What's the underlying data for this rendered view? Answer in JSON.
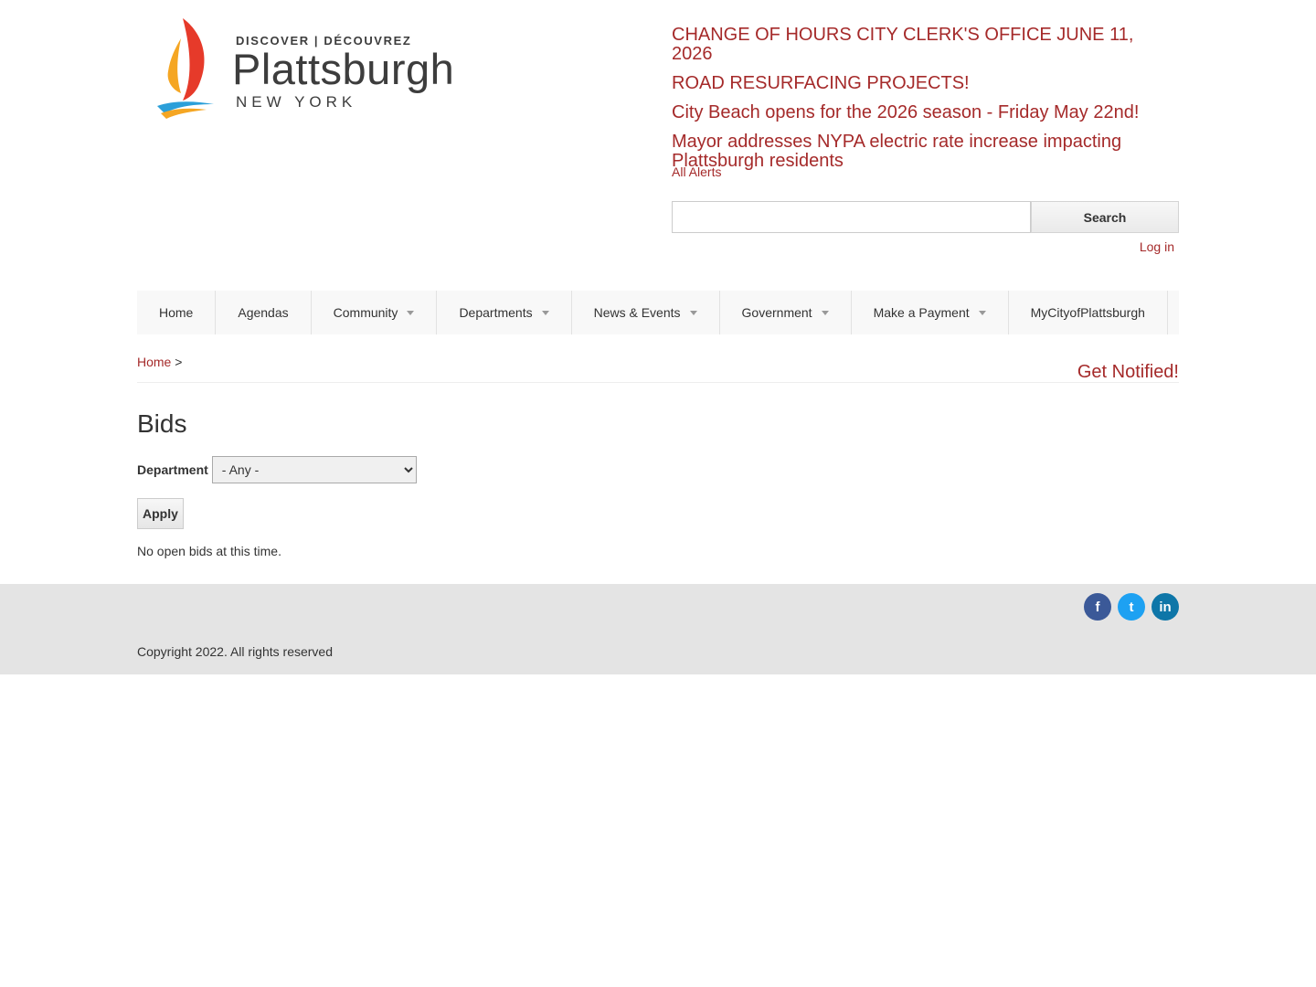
{
  "brand": {
    "discover": "DISCOVER | DÉCOUVREZ",
    "name": "Plattsburgh",
    "region": "NEW YORK"
  },
  "alerts": {
    "items": [
      "CHANGE OF HOURS CITY CLERK'S OFFICE JUNE 11, 2026",
      "ROAD RESURFACING PROJECTS!",
      "City Beach opens for the 2026 season - Friday May 22nd!",
      "Mayor addresses NYPA electric rate increase impacting Plattsburgh residents"
    ],
    "all_label": "All Alerts"
  },
  "search": {
    "value": "",
    "button_label": "Search"
  },
  "login_label": "Log in",
  "nav": {
    "items": [
      {
        "label": "Home",
        "dropdown": false
      },
      {
        "label": "Agendas",
        "dropdown": false
      },
      {
        "label": "Community",
        "dropdown": true
      },
      {
        "label": "Departments",
        "dropdown": true
      },
      {
        "label": "News & Events",
        "dropdown": true
      },
      {
        "label": "Government",
        "dropdown": true
      },
      {
        "label": "Make a Payment",
        "dropdown": true
      },
      {
        "label": "MyCityofPlattsburgh",
        "dropdown": false
      }
    ]
  },
  "breadcrumb": {
    "home": "Home",
    "separator": ">"
  },
  "get_notified": "Get Notified!",
  "page": {
    "title": "Bids",
    "filter_label": "Department",
    "filter_selected": "- Any -",
    "apply_label": "Apply",
    "empty_message": "No open bids at this time."
  },
  "footer": {
    "social": [
      {
        "name": "facebook-icon",
        "glyph": "f",
        "color": "#3b5998"
      },
      {
        "name": "twitter-icon",
        "glyph": "t",
        "color": "#1da1f2"
      },
      {
        "name": "linkedin-icon",
        "glyph": "in",
        "color": "#0e76a8"
      }
    ],
    "copyright": "Copyright 2022. All rights reserved"
  },
  "colors": {
    "accent": "#a52a2a",
    "footer_bg": "#e4e4e4",
    "nav_bg": "#f8f8f8"
  }
}
